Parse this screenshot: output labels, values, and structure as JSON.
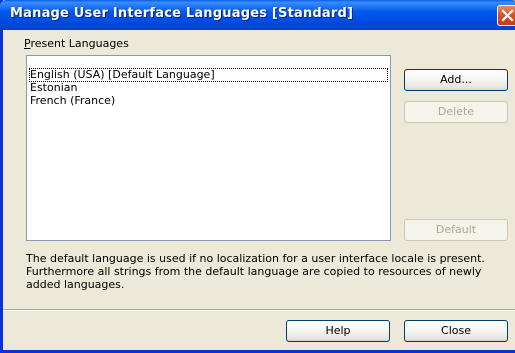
{
  "window": {
    "title": "Manage User Interface Languages [Standard]"
  },
  "present_languages": {
    "label_mnemonic": "P",
    "label_rest": "resent Languages",
    "items": [
      "English (USA) [Default Language]",
      "Estonian",
      "French (France)"
    ]
  },
  "buttons": {
    "add": "Add...",
    "delete": "Delete",
    "default": "Default",
    "help": "Help",
    "close": "Close"
  },
  "info": {
    "text": "The default language is used if no localization for a user interface locale is present. Furthermore all strings from the default language are copied to resources of newly added languages."
  },
  "colors": {
    "titlebar": "#0058ee",
    "dialog_bg": "#ece9d8",
    "close_button": "#d8542c",
    "disabled_text": "#aca899"
  },
  "icons": {
    "close": "close-x-icon"
  }
}
